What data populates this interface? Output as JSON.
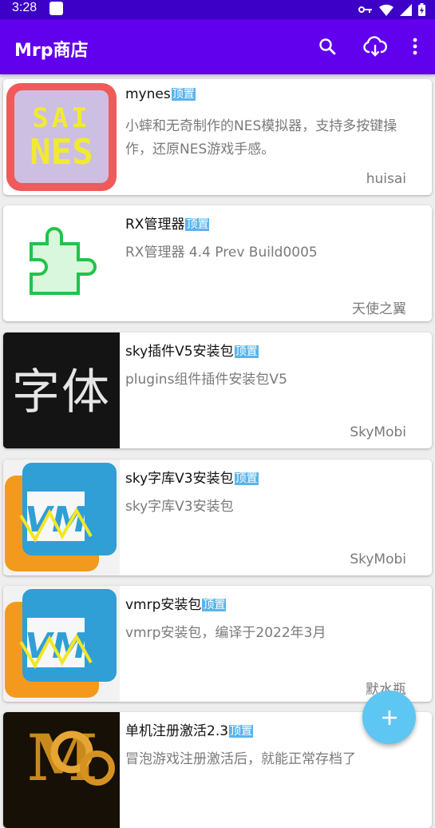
{
  "status": {
    "time": "3:28"
  },
  "appbar": {
    "title": "Mrp商店"
  },
  "badge_label": "顶置",
  "items": [
    {
      "name": "mynes",
      "desc": "小蟀和无奇制作的NES模拟器，支持多按键操作，还原NES游戏手感。",
      "author": "huisai",
      "thumb_text": [
        "SAI",
        "NES"
      ]
    },
    {
      "name": "RX管理器",
      "desc": "RX管理器 4.4 Prev Build0005",
      "author": "天使之翼"
    },
    {
      "name": "sky插件V5安装包",
      "desc": "plugins组件插件安装包V5",
      "author": "SkyMobi",
      "thumb_text": "字体"
    },
    {
      "name": "sky字库V3安装包",
      "desc": "sky字库V3安装包",
      "author": "SkyMobi",
      "thumb_text": "VM"
    },
    {
      "name": "vmrp安装包",
      "desc": "vmrp安装包，编译于2022年3月",
      "author": "默水瓶",
      "thumb_text": "VM"
    },
    {
      "name": "单机注册激活2.3",
      "desc": "冒泡游戏注册激活后，就能正常存档了",
      "author": ""
    }
  ],
  "colors": {
    "status_bar": "#3d00c6",
    "app_bar": "#6100ec",
    "badge": "#5ab4ec",
    "fab": "#5ec6f3"
  },
  "icons": [
    "search-icon",
    "download-icon",
    "more-vert-icon",
    "add-icon"
  ]
}
